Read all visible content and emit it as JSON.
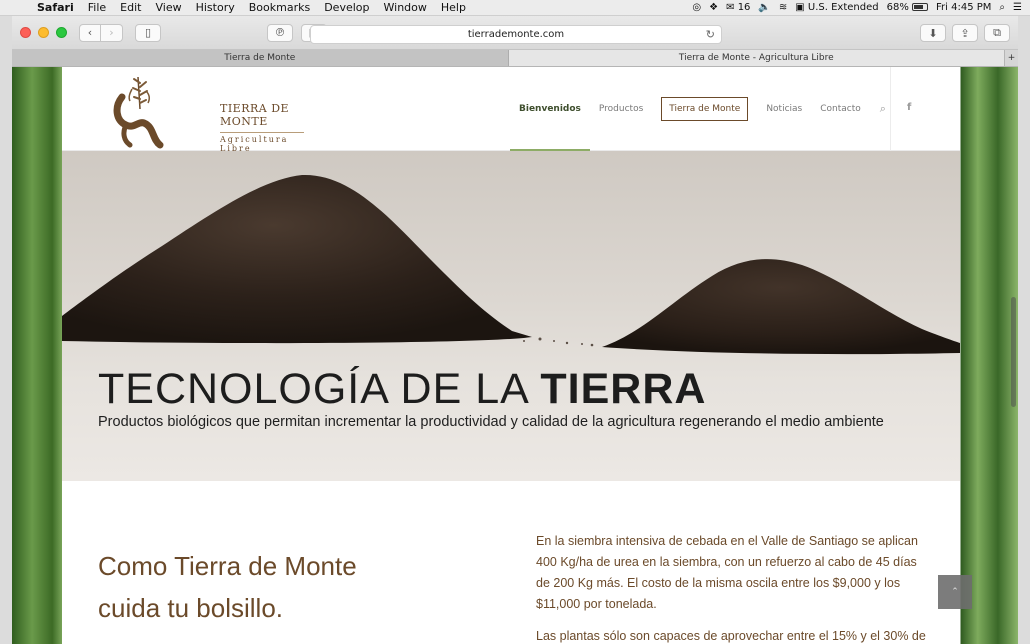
{
  "menubar": {
    "app": "Safari",
    "items": [
      "File",
      "Edit",
      "View",
      "History",
      "Bookmarks",
      "Develop",
      "Window",
      "Help"
    ],
    "status": {
      "notifications": "16",
      "input_source": "U.S. Extended",
      "battery": "68%",
      "clock": "Fri 4:45 PM"
    }
  },
  "browser": {
    "url": "tierrademonte.com",
    "tabs": [
      {
        "title": "Tierra de Monte"
      },
      {
        "title": "Tierra de Monte - Agricultura Libre"
      }
    ]
  },
  "site": {
    "brand_name": "TIERRA DE MONTE",
    "brand_tagline": "Agricultura Libre",
    "nav": {
      "home": "Bienvenidos",
      "products": "Productos",
      "about": "Tierra de Monte",
      "news": "Noticias",
      "contact": "Contacto"
    },
    "hero": {
      "title_light": "TECNOLOGÍA DE LA ",
      "title_bold": "TIERRA",
      "subtitle": "Productos biológicos que permitan incrementar la productividad y calidad de la agricultura regenerando el medio ambiente"
    },
    "intro": {
      "slogan_line1": "Como Tierra de Monte",
      "slogan_line2": "cuida tu bolsillo.",
      "paragraph1": "En la siembra intensiva de cebada en el Valle de Santiago se aplican 400 Kg/ha de urea en la siembra, con un refuerzo al cabo de 45 días de 200 Kg más. El costo de la misma oscila entre los $9,000 y los $11,000 por tonelada.",
      "paragraph2": "Las plantas sólo son capaces de aprovechar entre el 15% y el 30% de"
    }
  },
  "colors": {
    "brand_brown": "#6b4a2a",
    "nav_active_underline": "#8dac66",
    "soil": "#2a1f18"
  }
}
